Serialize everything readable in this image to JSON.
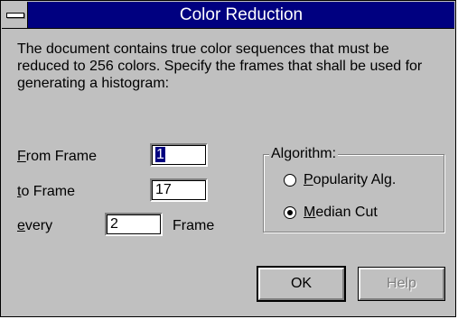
{
  "dialog": {
    "title": "Color Reduction",
    "description": "The document contains true color sequences that must be reduced to 256 colors. Specify the frames that shall be used for generating a histogram:"
  },
  "from_frame": {
    "label_hotkey": "F",
    "label_rest": "rom Frame",
    "value": "1"
  },
  "to_frame": {
    "label_hotkey": "t",
    "label_rest": "o Frame",
    "value": "17"
  },
  "every": {
    "label_hotkey": "e",
    "label_rest": "very",
    "value": "2",
    "suffix": "Frame"
  },
  "algorithm": {
    "title": "Algorithm:",
    "options": [
      {
        "hotkey": "P",
        "rest": "opularity Alg.",
        "selected": false
      },
      {
        "hotkey": "M",
        "rest": "edian Cut",
        "selected": true
      }
    ]
  },
  "buttons": {
    "ok": "OK",
    "help": "Help"
  },
  "colors": {
    "titlebar": "#000080",
    "face": "#c0c0c0",
    "selection": "#000080"
  },
  "icons": {
    "system_menu": "system-menu-icon",
    "radio": "radio-button-icon"
  }
}
